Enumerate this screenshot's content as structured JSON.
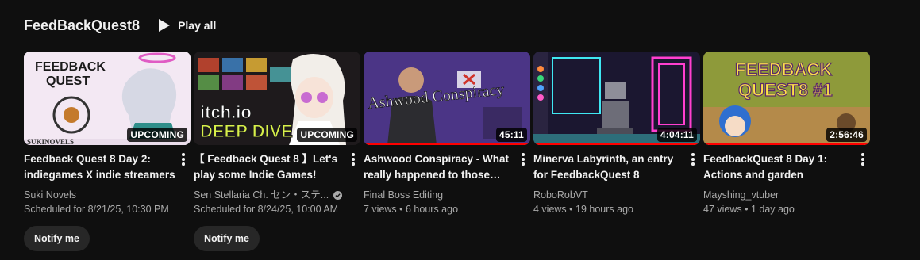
{
  "shelf": {
    "title": "FeedBackQuest8",
    "play_all_label": "Play all"
  },
  "videos": [
    {
      "title": "Feedback Quest 8 Day 2: indiegames X indie streamers",
      "channel": "Suki Novels",
      "stats": "Scheduled for 8/21/25, 10:30 PM",
      "badge": "UPCOMING",
      "notify_label": "Notify me",
      "thumb_text": {
        "line1": "FEEDBACK",
        "line2": "QUEST",
        "footer": "SUKINOVELS"
      }
    },
    {
      "title": "【 Feedback Quest 8 】Let's play some Indie Games!",
      "channel": "Sen Stellaria Ch. セン・ステ...",
      "stats": "Scheduled for 8/24/25, 10:00 AM",
      "badge": "UPCOMING",
      "notify_label": "Notify me",
      "thumb_text": {
        "line1": "itch.io",
        "line2": "DEEP DIVE"
      }
    },
    {
      "title": "Ashwood Conspiracy - What really happened to those…",
      "channel": "Final Boss Editing",
      "stats": "7 views • 6 hours ago",
      "badge": "45:11",
      "thumb_text": {
        "line1": "Ashwood Conspiracy"
      }
    },
    {
      "title": "Minerva Labyrinth, an entry for FeedbackQuest 8",
      "channel": "RoboRobVT",
      "stats": "4 views • 19 hours ago",
      "badge": "4:04:11"
    },
    {
      "title": "FeedbackQuest 8 Day 1: Actions and garden",
      "channel": "Mayshing_vtuber",
      "stats": "47 views • 1 day ago",
      "badge": "2:56:46",
      "thumb_text": {
        "line1": "FEEDBACK",
        "line2": "QUEST8 #1"
      }
    }
  ],
  "colors": {
    "background": "#0f0f0f",
    "progress": "#ff0000",
    "secondary_text": "#aaaaaa"
  }
}
